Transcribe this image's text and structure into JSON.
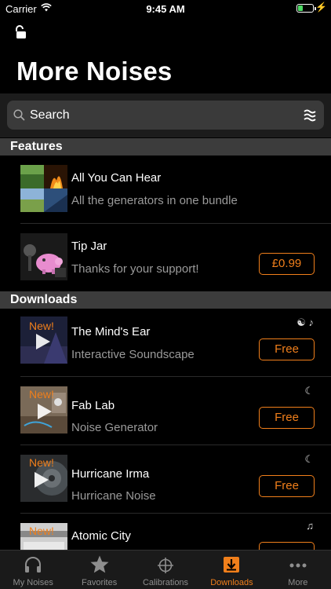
{
  "status": {
    "carrier": "Carrier",
    "time": "9:45 AM"
  },
  "page": {
    "title": "More Noises"
  },
  "search": {
    "placeholder": "Search"
  },
  "sections": {
    "features": "Features",
    "downloads": "Downloads"
  },
  "features": [
    {
      "title": "All You Can Hear",
      "subtitle": "All the generators in one bundle"
    },
    {
      "title": "Tip Jar",
      "subtitle": "Thanks for your support!",
      "price": "£0.99"
    }
  ],
  "downloads": [
    {
      "badge": "New!",
      "title": "The Mind's Ear",
      "subtitle": "Interactive Soundscape",
      "price": "Free",
      "meta": "☯ ♪"
    },
    {
      "badge": "New!",
      "title": "Fab Lab",
      "subtitle": "Noise Generator",
      "price": "Free",
      "meta": "☾"
    },
    {
      "badge": "New!",
      "title": "Hurricane Irma",
      "subtitle": "Hurricane Noise",
      "price": "Free",
      "meta": "☾"
    },
    {
      "badge": "New!",
      "title": "Atomic City",
      "subtitle": "",
      "price": "",
      "meta": "♫"
    }
  ],
  "tabs": [
    {
      "label": "My Noises",
      "icon": "headphones-icon"
    },
    {
      "label": "Favorites",
      "icon": "star-icon"
    },
    {
      "label": "Calibrations",
      "icon": "crosshair-icon"
    },
    {
      "label": "Downloads",
      "icon": "download-icon",
      "active": true
    },
    {
      "label": "More",
      "icon": "more-icon"
    }
  ],
  "colors": {
    "accent": "#f07f1b",
    "background": "#000000",
    "section": "#3c3c3c"
  }
}
